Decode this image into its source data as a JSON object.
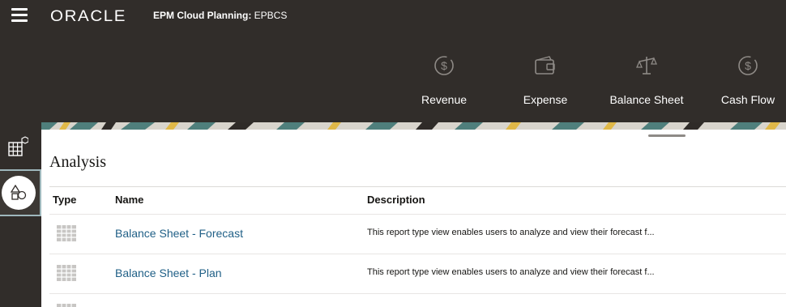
{
  "header": {
    "menu_icon": "hamburger-menu-icon",
    "logo": "ORACLE",
    "app_title_bold": "EPM Cloud Planning:",
    "app_title_rest": " EPBCS"
  },
  "cards": [
    {
      "label": "Revenue",
      "icon": "dollar-cycle-icon"
    },
    {
      "label": "Expense",
      "icon": "wallet-icon"
    },
    {
      "label": "Balance Sheet",
      "icon": "scale-icon"
    },
    {
      "label": "Cash Flow",
      "icon": "dollar-cycle-icon"
    }
  ],
  "left_rail": [
    {
      "icon": "grid-cube-icon"
    },
    {
      "icon": "shapes-icon",
      "selected": true
    }
  ],
  "panel": {
    "title": "Analysis",
    "columns": [
      "Type",
      "Name",
      "Description"
    ],
    "rows": [
      {
        "icon": "grid-report-icon",
        "name": "Balance Sheet - Forecast",
        "description": "This report type view enables users to analyze and view their forecast f..."
      },
      {
        "icon": "grid-report-icon",
        "name": "Balance Sheet - Plan",
        "description": "This report type view enables users to analyze and view their forecast f..."
      }
    ]
  },
  "colors": {
    "header_bg": "#312d2a",
    "link": "#1f5f86",
    "rail_selected_border": "#9eb7bc"
  }
}
